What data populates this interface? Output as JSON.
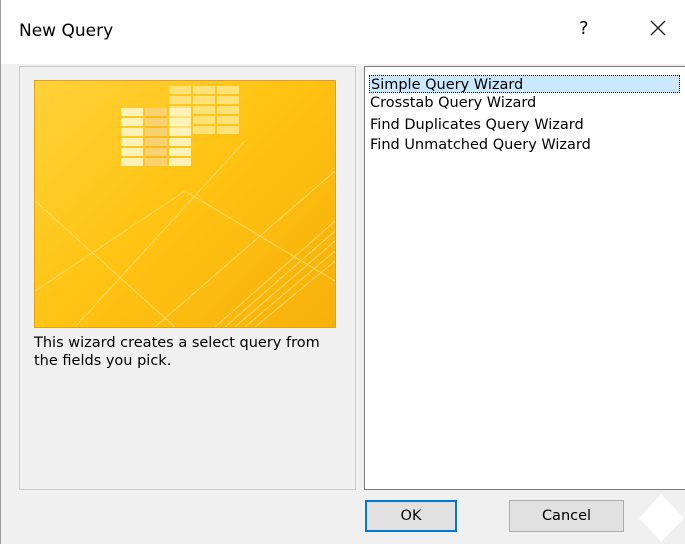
{
  "dialog": {
    "title": "New Query",
    "help_label": "?"
  },
  "preview": {
    "icon": "query-wizard-illustration",
    "description": "This wizard creates a select query from the fields you pick."
  },
  "wizards": {
    "items": [
      {
        "label": "Simple Query Wizard",
        "selected": true
      },
      {
        "label": "Crosstab Query Wizard",
        "selected": false
      },
      {
        "label": "Find Duplicates Query Wizard",
        "selected": false
      },
      {
        "label": "Find Unmatched Query Wizard",
        "selected": false
      }
    ]
  },
  "buttons": {
    "ok_label": "OK",
    "cancel_label": "Cancel"
  },
  "colors": {
    "accent": "#0078d7",
    "selection": "#cce8ff",
    "preview_gold": "#ffc414"
  }
}
